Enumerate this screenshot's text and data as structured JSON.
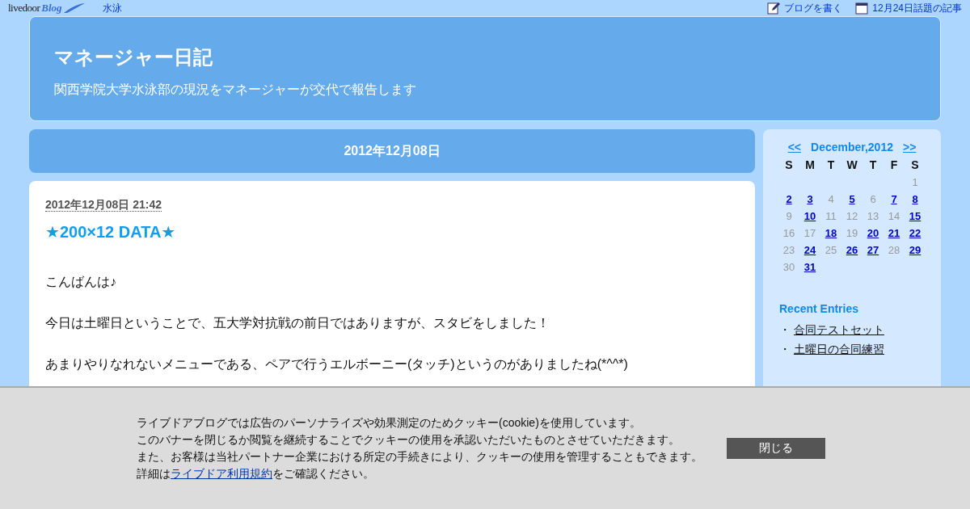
{
  "topbar": {
    "logo": {
      "brand": "livedoor",
      "product": "Blog"
    },
    "category_link": "水泳",
    "links": [
      {
        "kind": "write",
        "label": "ブログを書く"
      },
      {
        "kind": "calendar",
        "label": "12月24日話題の記事"
      }
    ]
  },
  "header": {
    "title": "マネージャー日記",
    "subtitle": "関西学院大学水泳部の現況をマネージャーが交代で報告します"
  },
  "date_heading": "2012年12月08日",
  "post": {
    "timestamp": "2012年12月08日 21:42",
    "title": "★200×12 DATA★",
    "paragraphs": [
      "こんばんは♪",
      "今日は土曜日ということで、五大学対抗戦の前日ではありますが、スタビをしました！",
      "あまりやりなれないメニューである、ペアで行うエルボーニー(タッチ)というのがありましたね(*^^*)"
    ]
  },
  "calendar": {
    "prev": "<<",
    "title": "December,2012",
    "next": ">>",
    "weekdays": [
      "S",
      "M",
      "T",
      "W",
      "T",
      "F",
      "S"
    ],
    "weeks": [
      {
        "days": [
          {
            "day": "1",
            "linked": false
          }
        ]
      },
      {
        "days": [
          {
            "day": "2",
            "linked": true
          },
          {
            "day": "3",
            "linked": true
          },
          {
            "day": "4",
            "linked": false
          },
          {
            "day": "5",
            "linked": true
          },
          {
            "day": "6",
            "linked": false
          },
          {
            "day": "7",
            "linked": true
          },
          {
            "day": "8",
            "linked": true
          }
        ]
      },
      {
        "days": [
          {
            "day": "9",
            "linked": false
          },
          {
            "day": "10",
            "linked": true
          },
          {
            "day": "11",
            "linked": false
          },
          {
            "day": "12",
            "linked": false
          },
          {
            "day": "13",
            "linked": false
          },
          {
            "day": "14",
            "linked": false
          },
          {
            "day": "15",
            "linked": true
          }
        ]
      },
      {
        "days": [
          {
            "day": "16",
            "linked": false
          },
          {
            "day": "17",
            "linked": false
          },
          {
            "day": "18",
            "linked": true
          },
          {
            "day": "19",
            "linked": false
          },
          {
            "day": "20",
            "linked": true
          },
          {
            "day": "21",
            "linked": true
          },
          {
            "day": "22",
            "linked": true
          }
        ]
      },
      {
        "days": [
          {
            "day": "23",
            "linked": false
          },
          {
            "day": "24",
            "linked": true
          },
          {
            "day": "25",
            "linked": false
          },
          {
            "day": "26",
            "linked": true
          },
          {
            "day": "27",
            "linked": true
          },
          {
            "day": "28",
            "linked": false
          },
          {
            "day": "29",
            "linked": true
          }
        ]
      },
      {
        "days": [
          {
            "day": "30",
            "linked": false
          },
          {
            "day": "31",
            "linked": true
          }
        ]
      }
    ]
  },
  "recent": {
    "title": "Recent Entries",
    "bullet": "・",
    "items": [
      "合同テストセット",
      "土曜日の合同練習"
    ]
  },
  "cookie_banner": {
    "lines": [
      "ライブドアブログでは広告のパーソナライズや効果測定のためクッキー(cookie)を使用しています。",
      "このバナーを閉じるか閲覧を継続することでクッキーの使用を承認いただいたものとさせていただきます。",
      "また、お客様は当社パートナー企業における所定の手続きにより、クッキーの使用を管理することもできます。"
    ],
    "last_line": {
      "before": "詳細は",
      "link": "ライブドア利用規約",
      "after": "をご確認ください。"
    },
    "close_button": "閉じる"
  }
}
